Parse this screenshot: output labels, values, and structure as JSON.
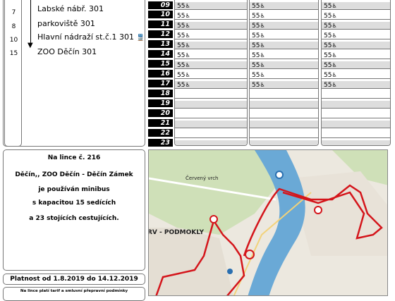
{
  "stops": {
    "minutes": [
      "7",
      "8",
      "10",
      "15"
    ],
    "names": [
      "Labské nábř.  301",
      "parkoviště  301",
      "Hlavní nádraží st.č.1  301",
      "ZOO Děčín  301"
    ],
    "train_icon": "train-icon"
  },
  "info": {
    "line1": "Na lince č. 216",
    "line2": "Děčín,, ZOO Děčín - Děčín Zámek",
    "line3": "je používán minibus",
    "line4": "s kapacitou 15 sedících",
    "line5": "a 23 stojících cestujících."
  },
  "validity": "Platnost od 1.8.2019 do 14.12.2019",
  "note": "Na lince platí tarif a smluvní přepravní podmínky",
  "hours": [
    "09",
    "10",
    "11",
    "12",
    "13",
    "14",
    "15",
    "16",
    "17",
    "18",
    "19",
    "20",
    "21",
    "22",
    "23"
  ],
  "columns": [
    [
      "55",
      "55",
      "55",
      "55",
      "55",
      "55",
      "55",
      "55",
      "55",
      "",
      "",
      "",
      "",
      "",
      ""
    ],
    [
      "55",
      "55",
      "55",
      "55",
      "55",
      "55",
      "55",
      "55",
      "55",
      "",
      "",
      "",
      "",
      "",
      ""
    ],
    [
      "55",
      "55",
      "55",
      "55",
      "55",
      "55",
      "55",
      "55",
      "55",
      "",
      "",
      "",
      "",
      "",
      ""
    ]
  ],
  "map": {
    "label_podmokly": "RV - PODMOKLY",
    "label_cervenyvrch": "Červený vrch"
  },
  "colors": {
    "route": "#d4151b",
    "river": "#6aa9d6",
    "forest": "#cfe0b8"
  }
}
